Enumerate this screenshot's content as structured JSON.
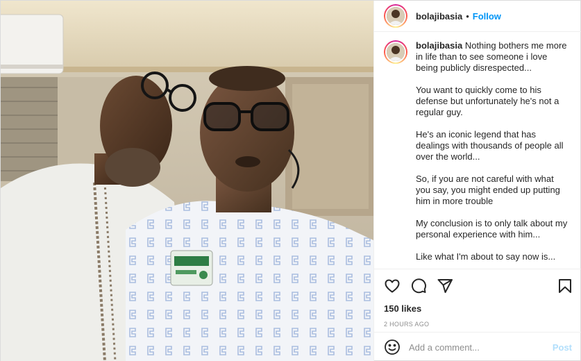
{
  "post": {
    "username": "bolajibasia",
    "follow_label": "Follow",
    "separator": "•",
    "caption_paragraphs": [
      "Nothing bothers me more in life than to see someone i love being publicly disrespected...",
      "You want to quickly come to his defense but unfortunately he's not a regular guy.",
      "He's an iconic legend that has dealings with thousands of people all over the world...",
      "So, if you are not careful with what you say, you might ended up putting him in more trouble",
      "My conclusion is to only talk about my personal experience with him...",
      "Like what I'm about to say now is..."
    ],
    "likes": "150 likes",
    "time_ago": "2 HOURS AGO",
    "comment_placeholder": "Add a comment...",
    "post_label": "Post"
  },
  "icons": {
    "like": "heart-icon",
    "comment": "comment-icon",
    "share": "send-icon",
    "save": "bookmark-icon",
    "emoji": "emoji-icon"
  },
  "colors": {
    "follow": "#0095f6",
    "post_disabled": "#b2dffc",
    "meta": "#8e8e8e"
  }
}
